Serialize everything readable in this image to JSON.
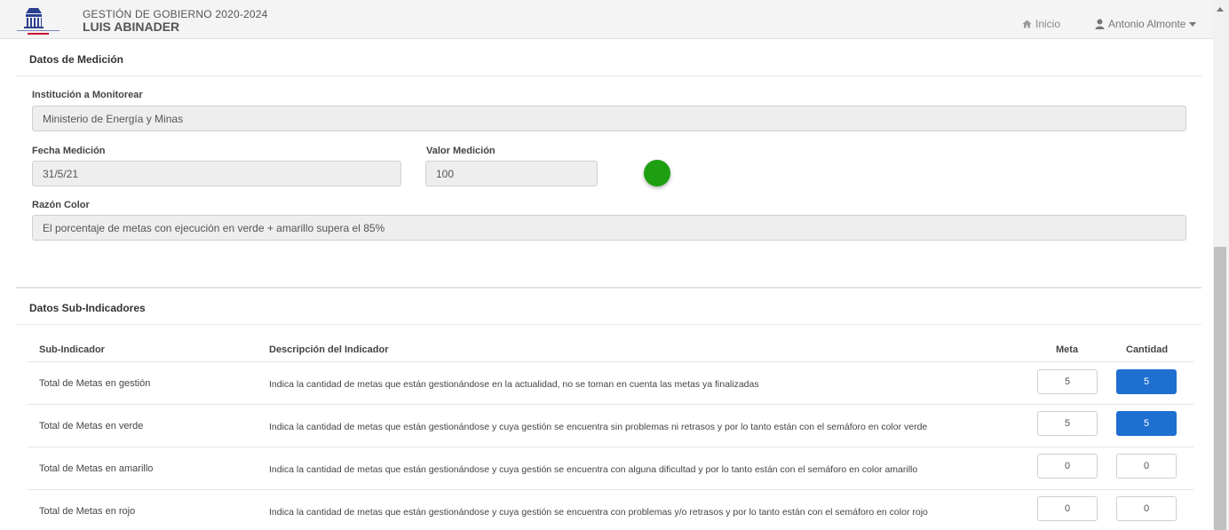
{
  "header": {
    "line1": "GESTIÓN DE GOBIERNO 2020-2024",
    "line2": "LUIS ABINADER",
    "home_label": "Inicio",
    "user_label": "Antonio Almonte",
    "icons": {
      "home": "home-icon",
      "user": "user-icon",
      "caret": "caret-down-icon",
      "logo": "government-shield-logo"
    }
  },
  "medicion": {
    "section_title": "Datos de Medición",
    "institucion_label": "Institución a Monitorear",
    "institucion_value": "Ministerio de Energía y Minas",
    "fecha_label": "Fecha Medición",
    "fecha_value": "31/5/21",
    "valor_label": "Valor Medición",
    "valor_value": "100",
    "status_color": "#1e9f12",
    "razon_label": "Razón Color",
    "razon_value": "El porcentaje de metas con ejecución en verde + amarillo supera el 85%"
  },
  "sub": {
    "section_title": "Datos Sub-Indicadores",
    "columns": {
      "sub": "Sub-Indicador",
      "desc": "Descripción del Indicador",
      "meta": "Meta",
      "cantidad": "Cantidad"
    },
    "rows": [
      {
        "name": "Total de Metas en gestión",
        "desc": "Indica la cantidad de metas que están gestionándose en la actualidad, no se toman en cuenta las metas ya finalizadas",
        "meta": "5",
        "cantidad": "5",
        "highlight": true
      },
      {
        "name": "Total de Metas en verde",
        "desc": "Indica la cantidad de metas que están gestionándose y cuya gestión se encuentra sin problemas ni retrasos y por lo tanto están con el semáforo en color verde",
        "meta": "5",
        "cantidad": "5",
        "highlight": true
      },
      {
        "name": "Total de Metas en amarillo",
        "desc": "Indica la cantidad de metas que están gestionándose y cuya gestión se encuentra con alguna dificultad y por lo tanto están con el semáforo en color amarillo",
        "meta": "0",
        "cantidad": "0",
        "highlight": false
      },
      {
        "name": "Total de Metas en rojo",
        "desc": "Indica la cantidad de metas que están gestionándose y cuya gestión se encuentra con problemas y/o retrasos y por lo tanto están con el semáforo en color rojo",
        "meta": "0",
        "cantidad": "0",
        "highlight": false
      }
    ],
    "highlight_color": "#1f6fd1"
  }
}
